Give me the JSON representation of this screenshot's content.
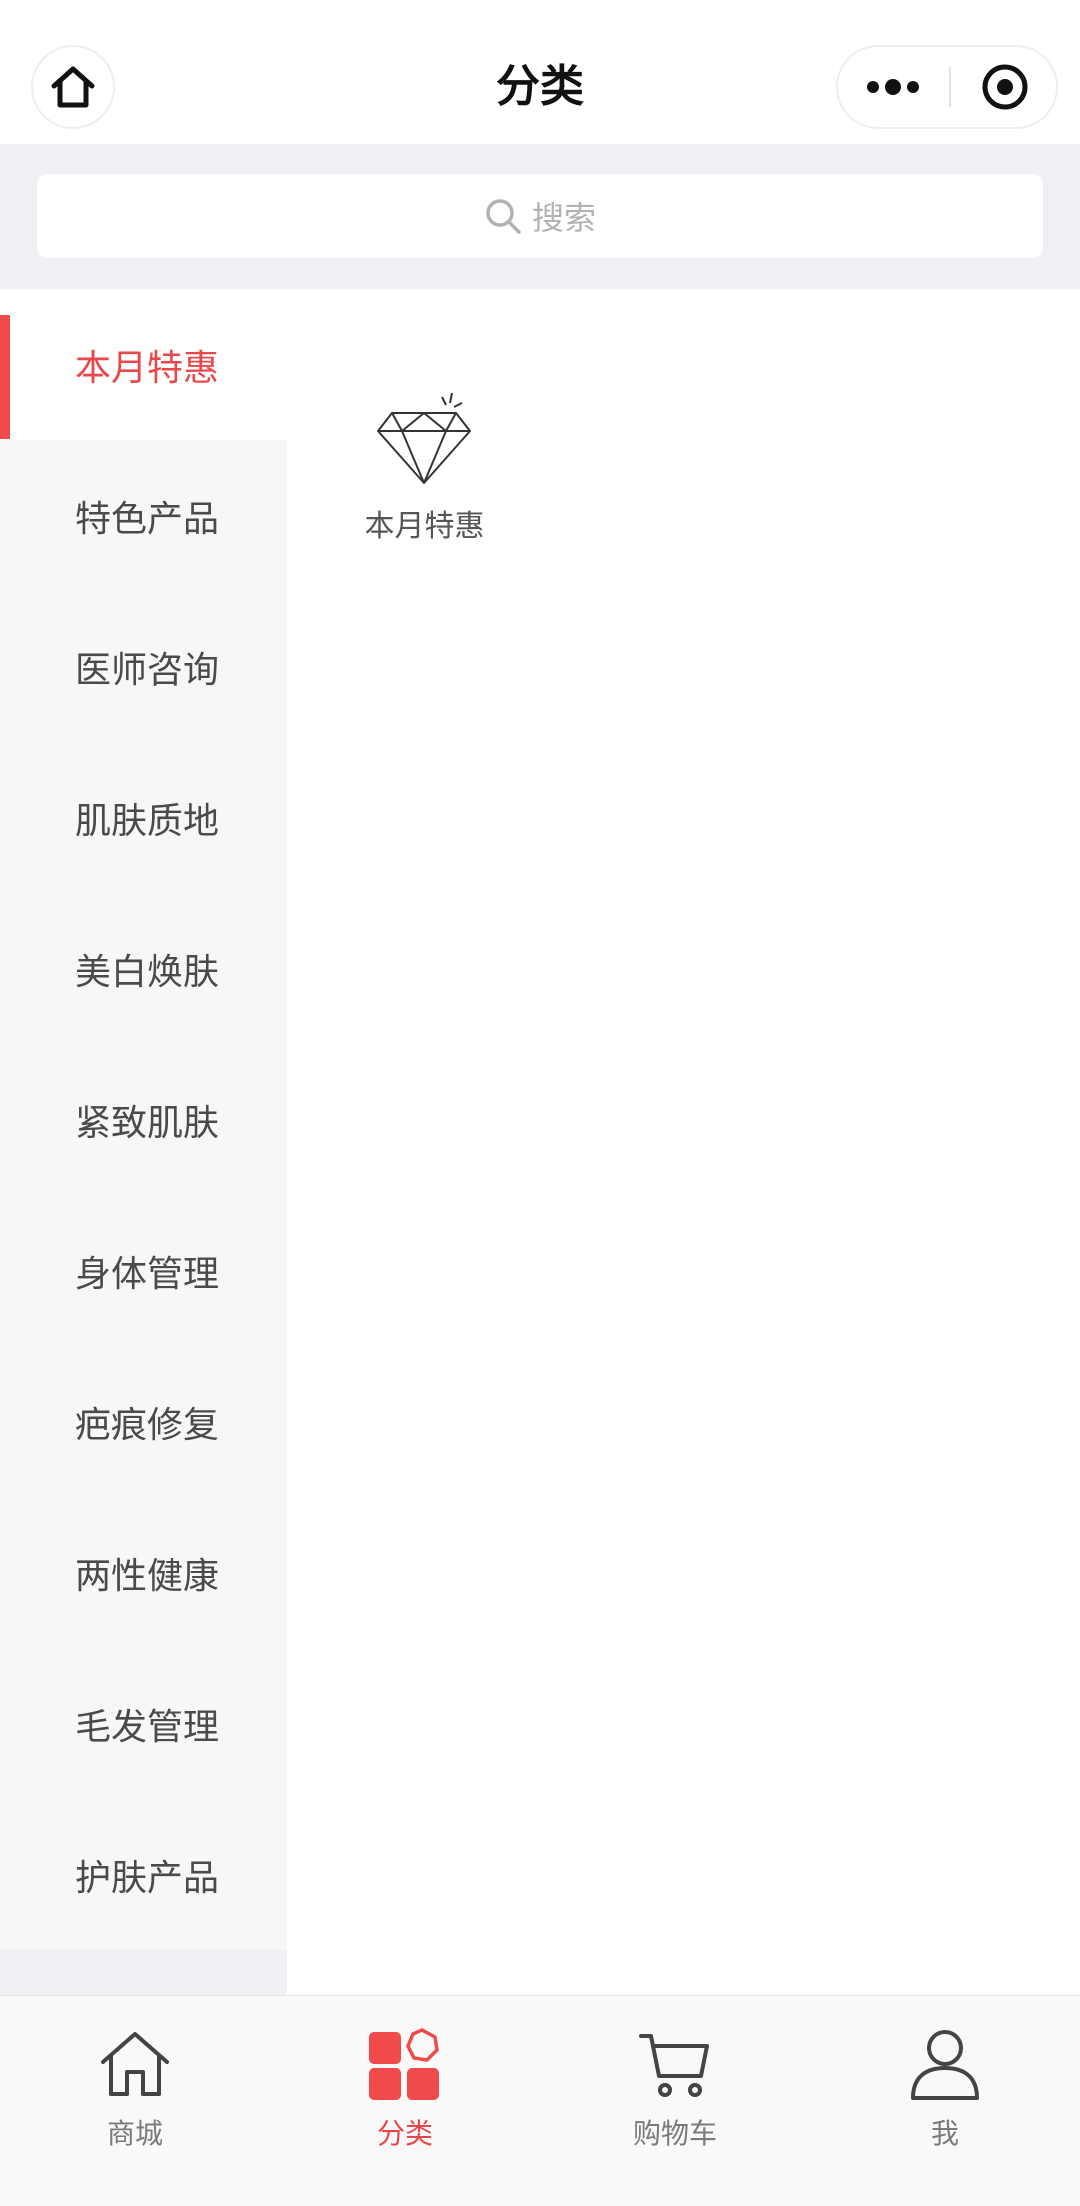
{
  "header": {
    "title": "分类"
  },
  "search": {
    "placeholder": "搜索"
  },
  "sidebar": {
    "items": [
      {
        "label": "本月特惠",
        "active": true
      },
      {
        "label": "特色产品"
      },
      {
        "label": "医师咨询"
      },
      {
        "label": "肌肤质地"
      },
      {
        "label": "美白焕肤"
      },
      {
        "label": "紧致肌肤"
      },
      {
        "label": "身体管理"
      },
      {
        "label": "疤痕修复"
      },
      {
        "label": "两性健康"
      },
      {
        "label": "毛发管理"
      },
      {
        "label": "护肤产品"
      }
    ]
  },
  "content": {
    "categories": [
      {
        "label": "本月特惠",
        "icon": "diamond-icon"
      }
    ]
  },
  "tabbar": {
    "tabs": [
      {
        "label": "商城",
        "icon": "home-outline-icon"
      },
      {
        "label": "分类",
        "icon": "category-grid-icon",
        "active": true
      },
      {
        "label": "购物车",
        "icon": "cart-icon"
      },
      {
        "label": "我",
        "icon": "user-icon"
      }
    ]
  },
  "colors": {
    "accent": "#e8484a",
    "sidebar_bg": "#f7f7f7",
    "search_bg": "#efeff4"
  }
}
